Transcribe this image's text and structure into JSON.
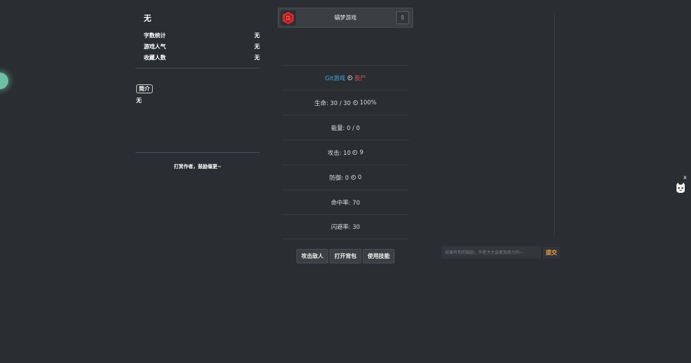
{
  "left": {
    "title": "无",
    "stats": [
      {
        "label": "字数统计",
        "value": "无"
      },
      {
        "label": "游戏人气",
        "value": "无"
      },
      {
        "label": "收藏人数",
        "value": "无"
      }
    ],
    "intro_label": "简介",
    "intro_text": "无",
    "tip": "打赏作者，鼓励催更~"
  },
  "header": {
    "title": "蠕梦游戏",
    "btn_glyph": "▯"
  },
  "battle": {
    "game_label": "Git游戏",
    "enemy_label": "丧尸",
    "hp": "生命: 30 / 30",
    "hp_pct": "100%",
    "energy": "能量: 0 / 0",
    "attack": "攻击: 10",
    "attack_bonus": "9",
    "defense": "防御: 0",
    "defense_bonus": "0",
    "hit_rate": "命中率: 70",
    "dodge_rate": "闪避率: 30"
  },
  "actions": {
    "attack": "攻击敌人",
    "bag": "打开背包",
    "skill": "使用技能"
  },
  "comment": {
    "placeholder": "如果有你的鼓励，作者大大会更加卖力的~",
    "submit": "提交"
  },
  "widget": {
    "close": "x"
  },
  "colors": {
    "background": "#2a2d31",
    "link": "#4aa3df",
    "enemy": "#e5534b",
    "submit": "#f0a24a",
    "logo": "#d92b2b"
  }
}
